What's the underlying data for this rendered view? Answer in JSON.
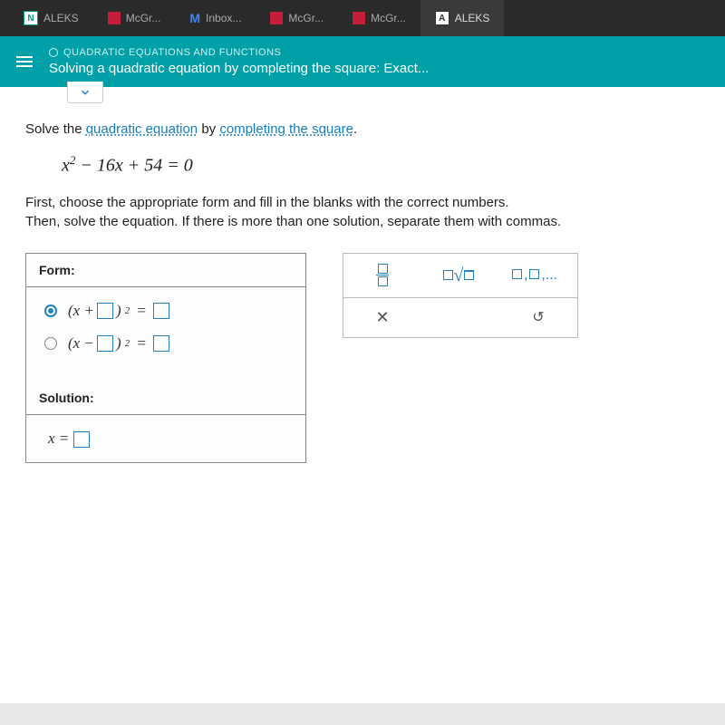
{
  "tabs": [
    {
      "label": "ALEKS",
      "icon": "N"
    },
    {
      "label": "McGr...",
      "icon": "mcgr"
    },
    {
      "label": "Inbox...",
      "icon": "M"
    },
    {
      "label": "McGr...",
      "icon": "mcgr"
    },
    {
      "label": "McGr...",
      "icon": "mcgr"
    },
    {
      "label": "ALEKS",
      "icon": "A"
    }
  ],
  "header": {
    "breadcrumb": "QUADRATIC EQUATIONS AND FUNCTIONS",
    "title": "Solving a quadratic equation by completing the square: Exact..."
  },
  "problem": {
    "intro1": "Solve the ",
    "term1": "quadratic equation",
    "intro2": " by ",
    "term2": "completing the square",
    "intro3": ".",
    "equation_raw": "x² − 16x + 54 = 0",
    "instr_line1": "First, choose the appropriate form and fill in the blanks with the correct numbers.",
    "instr_line2": "Then, solve the equation. If there is more than one solution, separate them with commas."
  },
  "form": {
    "label": "Form:",
    "sol_label": "Solution:"
  },
  "glyphs": {
    "x_close": "✕",
    "undo": "↺",
    "sqrt": "√"
  }
}
